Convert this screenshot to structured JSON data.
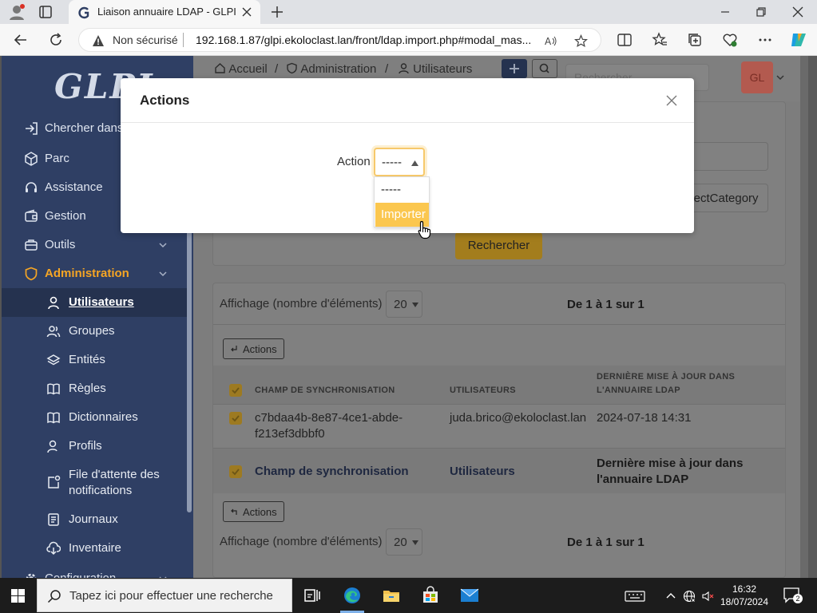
{
  "browser": {
    "tab_title": "Liaison annuaire LDAP - GLPI",
    "security_label": "Non sécurisé",
    "url": "192.168.1.87/glpi.ekoloclast.lan/front/ldap.import.php#modal_mas..."
  },
  "sidebar": {
    "logo": "GLPI",
    "items": [
      {
        "label": "Chercher dans"
      },
      {
        "label": "Parc"
      },
      {
        "label": "Assistance"
      },
      {
        "label": "Gestion"
      },
      {
        "label": "Outils"
      },
      {
        "label": "Administration"
      }
    ],
    "sub_items": [
      {
        "label": "Utilisateurs"
      },
      {
        "label": "Groupes"
      },
      {
        "label": "Entités"
      },
      {
        "label": "Règles"
      },
      {
        "label": "Dictionnaires"
      },
      {
        "label": "Profils"
      },
      {
        "label": "File d'attente des notifications"
      },
      {
        "label": "Journaux"
      },
      {
        "label": "Inventaire"
      }
    ],
    "partial_item": "Configuration"
  },
  "header": {
    "breadcrumb": [
      "Accueil",
      "Administration",
      "Utilisateurs"
    ],
    "search_placeholder": "Rechercher",
    "avatar_initials": "GL"
  },
  "search_form": {
    "partial_field": "ojectCategory",
    "search_button": "Rechercher"
  },
  "results": {
    "display_label": "Affichage (nombre d'éléments)",
    "per_page": "20",
    "pager": "De 1 à 1 sur 1",
    "actions_label": "Actions",
    "columns": [
      "CHAMP DE SYNCHRONISATION",
      "UTILISATEURS",
      "DERNIÈRE MISE À JOUR DANS L'ANNUAIRE LDAP"
    ],
    "rows": [
      {
        "sync_field": "c7bdaa4b-8e87-4ce1-abde-f213ef3dbbf0",
        "user": "juda.brico@ekoloclast.lan",
        "last_update": "2024-07-18 14:31"
      }
    ],
    "footer": [
      "Champ de synchronisation",
      "Utilisateurs",
      "Dernière mise à jour dans l'annuaire LDAP"
    ]
  },
  "modal": {
    "title": "Actions",
    "field_label": "Action",
    "selected": "-----",
    "options": [
      "-----",
      "Importer"
    ],
    "highlighted_option": "Importer"
  },
  "taskbar": {
    "search_placeholder": "Tapez ici pour effectuer une recherche",
    "time": "16:32",
    "date": "18/07/2024",
    "notification_count": "2"
  }
}
